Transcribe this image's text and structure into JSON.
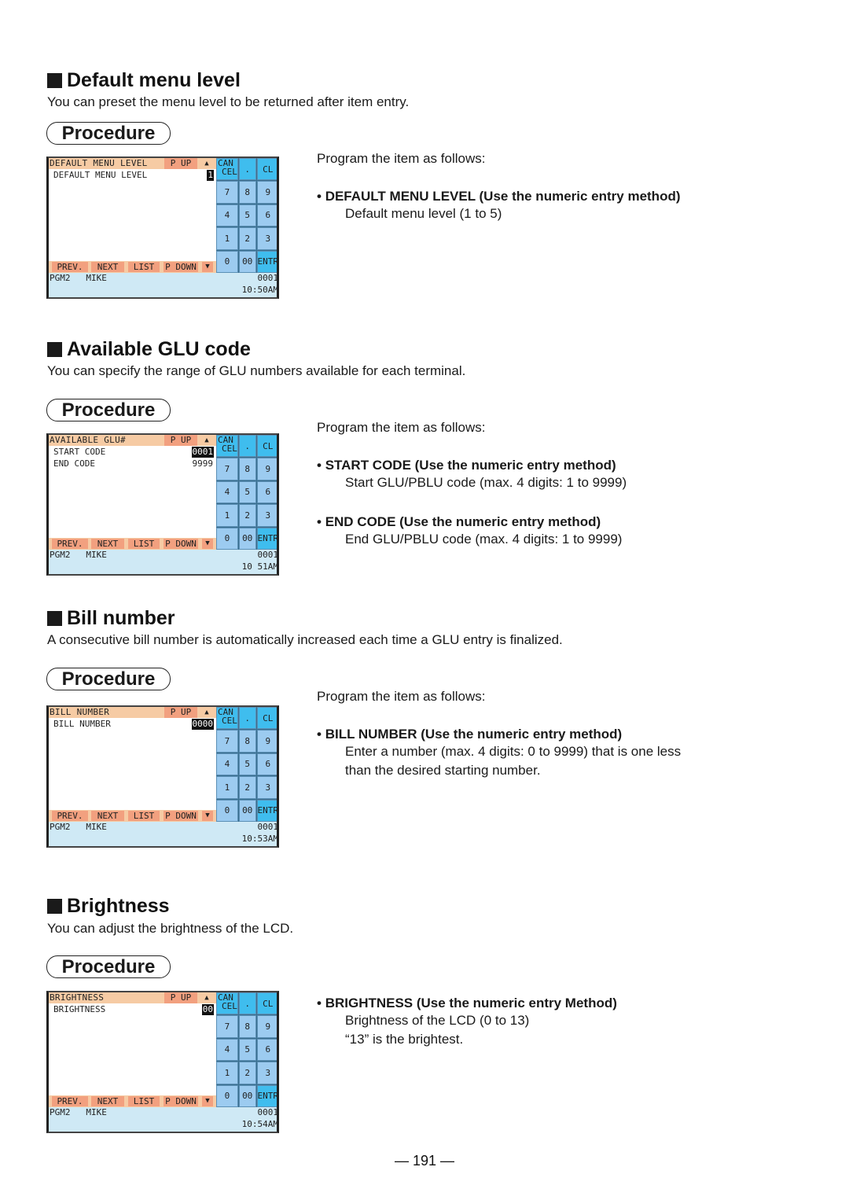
{
  "sections": [
    {
      "title": "Default menu level",
      "description": "You can preset the menu level to be returned after item entry.",
      "procedure_label": "Procedure",
      "intro": "Program the item as follows:",
      "items": [
        {
          "title": "DEFAULT MENU LEVEL (Use the numeric entry method)",
          "lines": [
            "Default menu level (1 to 5)"
          ]
        }
      ],
      "screen": {
        "header": "DEFAULT MENU LEVEL",
        "rows": [
          {
            "label": "DEFAULT MENU LEVEL",
            "value": "1",
            "selected": true
          }
        ],
        "time": "10:50AM"
      }
    },
    {
      "title": "Available GLU code",
      "description": "You can specify the range of GLU numbers available for each terminal.",
      "procedure_label": "Procedure",
      "intro": "Program the item as follows:",
      "items": [
        {
          "title": "START CODE (Use the numeric entry method)",
          "lines": [
            "Start GLU/PBLU code (max. 4 digits: 1 to 9999)"
          ]
        },
        {
          "title": "END CODE (Use the numeric entry method)",
          "lines": [
            "End GLU/PBLU code (max. 4 digits: 1 to 9999)"
          ]
        }
      ],
      "screen": {
        "header": "AVAILABLE GLU#",
        "rows": [
          {
            "label": "START CODE",
            "value": "0001",
            "selected": true
          },
          {
            "label": "END CODE",
            "value": "9999",
            "selected": false
          }
        ],
        "time": "10 51AM"
      }
    },
    {
      "title": "Bill number",
      "description": "A consecutive bill number is automatically increased each time a GLU entry is finalized.",
      "procedure_label": "Procedure",
      "intro": "Program the item as follows:",
      "items": [
        {
          "title": "BILL NUMBER (Use the numeric entry method)",
          "lines": [
            "Enter a number (max. 4 digits: 0 to 9999) that is one less",
            "than the desired starting number."
          ]
        }
      ],
      "screen": {
        "header": "BILL NUMBER",
        "rows": [
          {
            "label": "BILL NUMBER",
            "value": "0000",
            "selected": true
          }
        ],
        "time": "10:53AM"
      }
    },
    {
      "title": "Brightness",
      "description": "You can adjust the brightness of the LCD.",
      "procedure_label": "Procedure",
      "intro": "",
      "items": [
        {
          "title": "BRIGHTNESS (Use the numeric entry Method)",
          "lines": [
            "Brightness of the LCD (0 to 13)",
            "“13” is the brightest."
          ]
        }
      ],
      "screen": {
        "header": "BRIGHTNESS",
        "rows": [
          {
            "label": "BRIGHTNESS",
            "value": "00",
            "selected": true
          }
        ],
        "time": "10:54AM"
      }
    }
  ],
  "screen_common": {
    "page_up": "P UP",
    "up_arrow": "▲",
    "down_arrow": "▼",
    "footer_buttons": [
      "PREV.",
      "NEXT",
      "LIST",
      "P DOWN"
    ],
    "keypad": [
      "CAN|CEL",
      ".",
      "CL",
      "7",
      "8",
      "9",
      "4",
      "5",
      "6",
      "1",
      "2",
      "3",
      "0",
      "00",
      "ENTR"
    ],
    "operator_mode": "PGM2",
    "operator_name": "MIKE",
    "terminal": "0001"
  },
  "colors": {
    "header_bg": "#f6cba4",
    "button_bg": "#f2a07f",
    "key_bg": "#9ccbf0",
    "key_highlight": "#3fbdee",
    "status_bg": "#cfe9f5"
  },
  "page_number": "— 191 —"
}
